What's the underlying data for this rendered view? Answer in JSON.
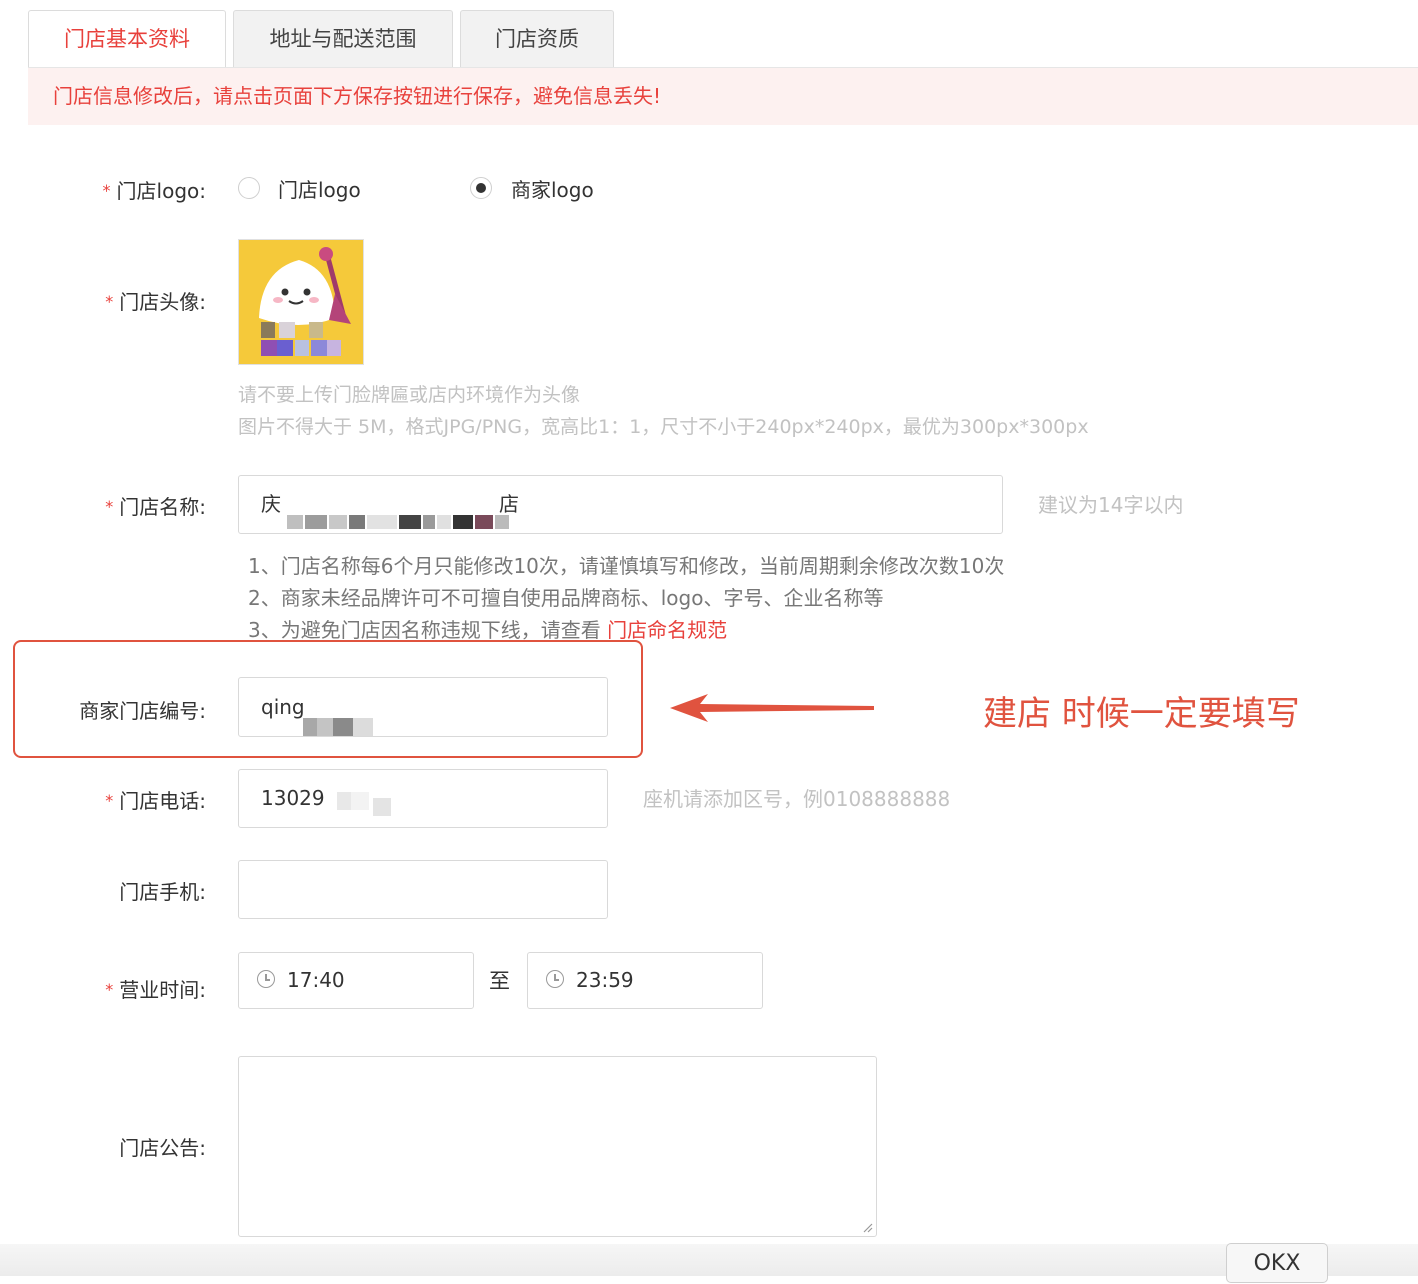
{
  "tabs": [
    {
      "label": "门店基本资料",
      "active": true
    },
    {
      "label": "地址与配送范围",
      "active": false
    },
    {
      "label": "门店资质",
      "active": false
    }
  ],
  "notice": "门店信息修改后，请点击页面下方保存按钮进行保存，避免信息丢失!",
  "form": {
    "logo": {
      "label": "门店logo:",
      "options": [
        {
          "label": "门店logo",
          "checked": false
        },
        {
          "label": "商家logo",
          "checked": true
        }
      ]
    },
    "avatar": {
      "label": "门店头像:",
      "hint1": "请不要上传门脸牌匾或店内环境作为头像",
      "hint2": "图片不得大于 5M，格式JPG/PNG，宽高比1：1，尺寸不小于240px*240px，最优为300px*300px"
    },
    "name": {
      "label": "门店名称:",
      "value": "庆",
      "value_tail": "店",
      "hint": "建议为14字以内",
      "rules": [
        "1、门店名称每6个月只能修改10次，请谨慎填写和修改，当前周期剩余修改次数10次",
        "2、商家未经品牌许可不可擅自使用品牌商标、logo、字号、企业名称等",
        "3、为避免门店因名称违规下线，请查看 "
      ],
      "rule_link": "门店命名规范"
    },
    "code": {
      "label": "商家门店编号:",
      "value": "qing"
    },
    "phone": {
      "label": "门店电话:",
      "value": "13029",
      "hint": "座机请添加区号，例0108888888"
    },
    "mobile": {
      "label": "门店手机:",
      "value": ""
    },
    "hours": {
      "label": "营业时间:",
      "start": "17:40",
      "separator": "至",
      "end": "23:59"
    },
    "announcement": {
      "label": "门店公告:",
      "value": ""
    }
  },
  "annotation": "建店 时候一定要填写",
  "ok_button": "OKX",
  "colors": {
    "accent": "#e8413c",
    "annotation": "#e0533f"
  }
}
